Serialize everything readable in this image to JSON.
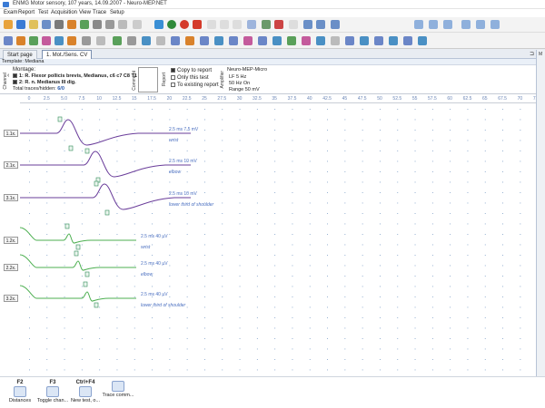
{
  "window": {
    "title": "ENMG Motor sensory, 107 years, 14.09.2007 - Neuro-MEP.NET"
  },
  "menu": [
    "Exam",
    "Report",
    "Test",
    "Acquisition",
    "View",
    "Trace",
    "Setup"
  ],
  "tabs": [
    {
      "label": "Start page"
    },
    {
      "label": "1. Mot./Sens. CV"
    }
  ],
  "template": {
    "label": "Template: Mediana"
  },
  "panel": {
    "channel": "Channel",
    "montage_title": "Montage:",
    "montage1": "1: R. Flexor pollicis brevis, Medianus, c6 c7 C8 T1",
    "montage2": "2: R. n. Medianus III dig.",
    "total_label": "Total traces/hidden:",
    "total_value": "6/0",
    "comment": "Comment",
    "report": "Report",
    "copy": "Copy to report",
    "only": "Only this test",
    "existing": "To existing report",
    "amplifier": "Amplifier",
    "device": "Neuro-MEP-Micro",
    "lf": "LF  5 Hz",
    "hf": "50 Hz  On",
    "range": "Range  50 mV"
  },
  "ruler": [
    "0",
    "2.5",
    "5.0",
    "7.5",
    "10",
    "12.5",
    "15",
    "17.5",
    "20",
    "22.5",
    "25",
    "27.5",
    "30",
    "32.5",
    "35",
    "37.5",
    "40",
    "42.5",
    "45",
    "47.5",
    "50",
    "52.5",
    "55",
    "57.5",
    "60",
    "62.5",
    "65",
    "67.5",
    "70",
    "72.5"
  ],
  "traces": [
    {
      "ch": "1.1",
      "scale": "2.5 ms 7.5 mV",
      "site": "wrist"
    },
    {
      "ch": "2.1",
      "scale": "2.5 ms 10 mV",
      "site": "elbow"
    },
    {
      "ch": "3.1",
      "scale": "2.5 ms 10 mV",
      "site": "lower third of shoulder"
    },
    {
      "ch": "1.2",
      "scale": "2.5 ms 40 µV",
      "site": "wrist"
    },
    {
      "ch": "2.2",
      "scale": "2.5 ms 40 µV",
      "site": "elbow"
    },
    {
      "ch": "3.2",
      "scale": "2.5 ms 40 µV",
      "site": "lower third of shoulder"
    }
  ],
  "bottom": [
    {
      "key": "F2",
      "label": "Distances"
    },
    {
      "key": "F3",
      "label": "Toggle chan..."
    },
    {
      "key": "Ctrl+F4",
      "label": "New test, o..."
    },
    {
      "key": "",
      "label": "Trace comm..."
    }
  ],
  "colors": {
    "motor": "#6a3d9a",
    "sensory": "#4caf50",
    "label": "#4a6fc0",
    "marker": "#2e8b57"
  }
}
